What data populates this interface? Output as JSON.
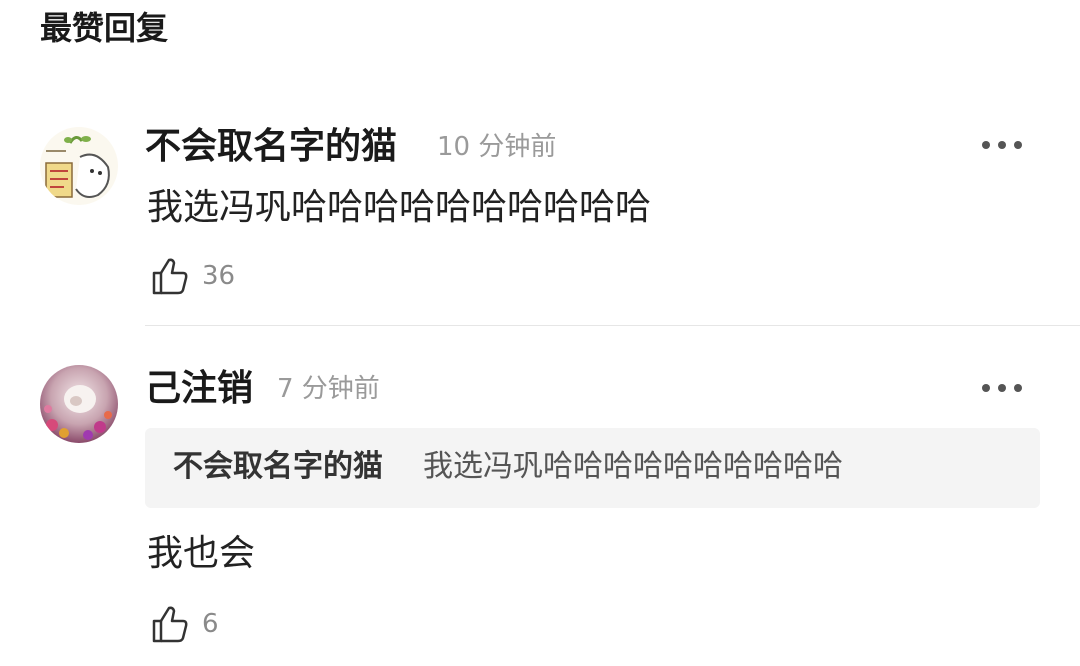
{
  "section_title": "最赞回复",
  "comments": [
    {
      "username": "不会取名字的猫",
      "timestamp": "10 分钟前",
      "text": "我选冯巩哈哈哈哈哈哈哈哈哈哈",
      "likes": "36",
      "avatar_icon": "sprout-sticker-avatar"
    },
    {
      "username": "己注销",
      "timestamp": "7 分钟前",
      "text": "我也会",
      "likes": "6",
      "avatar_icon": "floral-photo-avatar",
      "quote": {
        "username": "不会取名字的猫",
        "text": "我选冯巩哈哈哈哈哈哈哈哈哈哈"
      }
    }
  ]
}
